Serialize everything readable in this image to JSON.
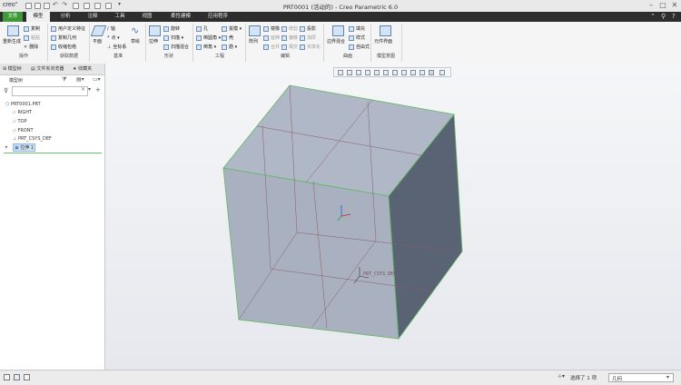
{
  "app": {
    "logo": "creo°",
    "window_title": "PRT0001 (活动的) - Creo Parametric 6.0"
  },
  "tabs": [
    "文件",
    "模型",
    "分析",
    "注释",
    "工具",
    "视图",
    "柔性建模",
    "应用程序"
  ],
  "ribbon": {
    "groups": [
      "操作",
      "获取数据",
      "基准",
      "形状",
      "工程",
      "编辑",
      "曲面",
      "模型意图"
    ],
    "ops": {
      "regen": "重新生成",
      "copy": "复制",
      "paste": "粘贴",
      "delete": "删除"
    },
    "data": {
      "udf": "用户定义特征",
      "copy_geom": "复制几何",
      "shrinkwrap": "收缩包络"
    },
    "datum": {
      "plane": "平面",
      "axis": "轴",
      "point": "点",
      "csys": "坐标系",
      "sketch": "草绘"
    },
    "shape": {
      "extrude": "拉伸",
      "revolve": "旋转",
      "sweep": "扫描",
      "swept_blend": "扫描混合"
    },
    "eng": {
      "hole": "孔",
      "round": "倒圆角",
      "chamfer": "倒角",
      "draft": "拔模",
      "shell": "壳",
      "rib": "筋"
    },
    "edit": {
      "pattern": "阵列",
      "mirror": "镜像",
      "extend": "延伸",
      "trim": "修剪",
      "offset": "偏移",
      "project": "投影",
      "merge": "合并",
      "thicken": "加厚",
      "intersect": "相交",
      "solidify": "实体化"
    },
    "surface": {
      "boundary_blend": "边界混合",
      "fill": "填充",
      "style": "样式",
      "freestyle": "自由式"
    },
    "intent": {
      "component_interface": "元件界面"
    }
  },
  "panel": {
    "tabs": [
      "模型树",
      "文件夹浏览器",
      "收藏夹"
    ],
    "tree_title": "模型树",
    "tree": [
      "PRT0001.PRT",
      "RIGHT",
      "TOP",
      "FRONT",
      "PRT_CSYS_DEF",
      "拉伸 1"
    ]
  },
  "graphics": {
    "csys_label": "PRT_CSYS_DEF"
  },
  "status": {
    "selected": "选择了 1 项",
    "filter": "几何"
  },
  "colors": {
    "tab_active": "#3e9a38",
    "solid_face": "#a9b1c1",
    "solid_side": "#5a6373",
    "selection_edge": "#5fb85f"
  }
}
